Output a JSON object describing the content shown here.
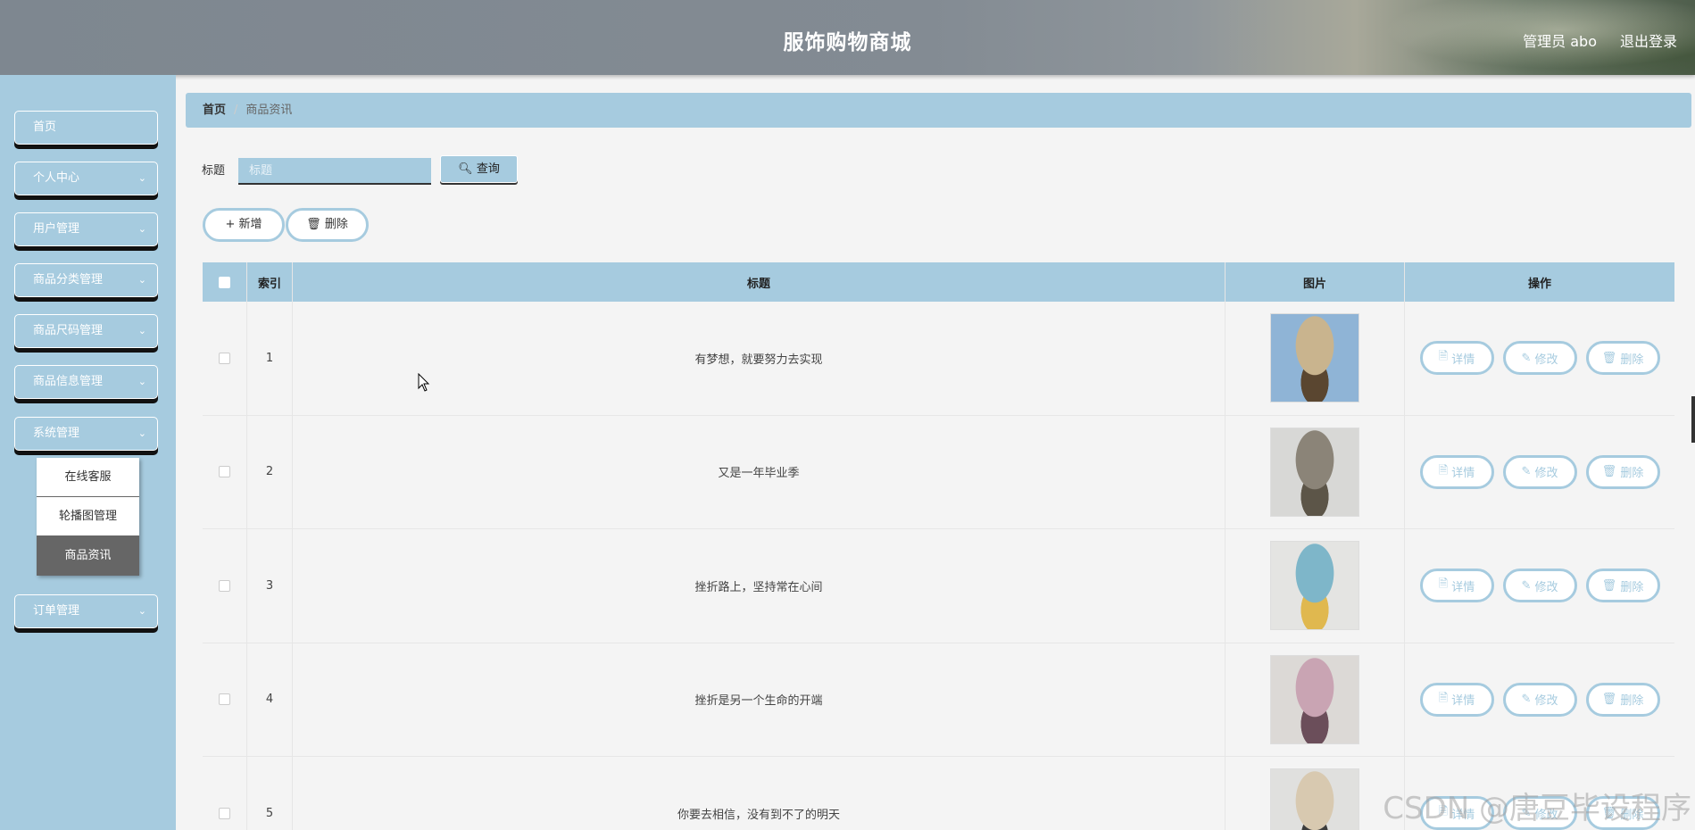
{
  "header": {
    "title": "服饰购物商城",
    "user": "管理员 abo",
    "logout": "退出登录"
  },
  "sidebar": {
    "items": [
      {
        "label": "首页",
        "chevron": false
      },
      {
        "label": "个人中心",
        "chevron": true
      },
      {
        "label": "用户管理",
        "chevron": true
      },
      {
        "label": "商品分类管理",
        "chevron": true
      },
      {
        "label": "商品尺码管理",
        "chevron": true
      },
      {
        "label": "商品信息管理",
        "chevron": true
      },
      {
        "label": "系统管理",
        "chevron": true
      },
      {
        "label": "订单管理",
        "chevron": true
      }
    ],
    "submenu": [
      {
        "label": "在线客服",
        "active": false
      },
      {
        "label": "轮播图管理",
        "active": false
      },
      {
        "label": "商品资讯",
        "active": true
      }
    ]
  },
  "breadcrumb": {
    "home": "首页",
    "separator": "/",
    "current": "商品资讯"
  },
  "search": {
    "label": "标题",
    "placeholder": "标题",
    "button": "查询"
  },
  "toolbar": {
    "add": "新增",
    "delete": "删除"
  },
  "table": {
    "headers": {
      "index": "索引",
      "title": "标题",
      "image": "图片",
      "actions": "操作"
    },
    "actions": {
      "detail": "详情",
      "edit": "修改",
      "delete": "删除"
    },
    "rows": [
      {
        "index": "1",
        "title": "有梦想，就要努力去实现",
        "image_colors": [
          "#8fb4d6",
          "#c9b48e",
          "#5a4630"
        ]
      },
      {
        "index": "2",
        "title": "又是一年毕业季",
        "image_colors": [
          "#d8d8d6",
          "#8b8478",
          "#5c5548"
        ]
      },
      {
        "index": "3",
        "title": "挫折路上，坚持常在心间",
        "image_colors": [
          "#e4e4e2",
          "#7eb6c9",
          "#e0b84f"
        ]
      },
      {
        "index": "4",
        "title": "挫折是另一个生命的开端",
        "image_colors": [
          "#dcd9d6",
          "#c9a4b3",
          "#6b4e5a"
        ]
      },
      {
        "index": "5",
        "title": "你要去相信，没有到不了的明天",
        "image_colors": [
          "#e0e0de",
          "#d8c9b0",
          "#3c3c3c"
        ]
      }
    ]
  },
  "watermark": "CSDN @唐豆毕设程序",
  "colors": {
    "accent": "#a6cbdf",
    "active_sub": "#666666"
  }
}
